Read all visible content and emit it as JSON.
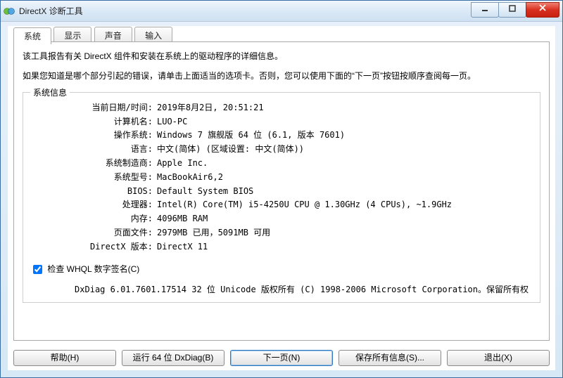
{
  "window": {
    "title": "DirectX 诊断工具"
  },
  "tabs": {
    "system": "系统",
    "display": "显示",
    "sound": "声音",
    "input": "输入"
  },
  "intro": {
    "line1": "该工具报告有关 DirectX 组件和安装在系统上的驱动程序的详细信息。",
    "line2": "如果您知道是哪个部分引起的错误，请单击上面适当的选项卡。否则，您可以使用下面的“下一页”按钮按顺序查阅每一页。"
  },
  "group_title": "系统信息",
  "sysinfo": {
    "datetime": {
      "label": "当前日期/时间:",
      "value": "2019年8月2日, 20:51:21"
    },
    "computer": {
      "label": "计算机名:",
      "value": "LUO-PC"
    },
    "os": {
      "label": "操作系统:",
      "value": "Windows 7 旗舰版 64 位 (6.1, 版本 7601)"
    },
    "language": {
      "label": "语言:",
      "value": "中文(简体) (区域设置: 中文(简体))"
    },
    "maker": {
      "label": "系统制造商:",
      "value": "Apple Inc."
    },
    "model": {
      "label": "系统型号:",
      "value": "MacBookAir6,2"
    },
    "bios": {
      "label": "BIOS:",
      "value": "Default System BIOS"
    },
    "cpu": {
      "label": "处理器:",
      "value": "Intel(R) Core(TM) i5-4250U CPU @ 1.30GHz (4 CPUs), ~1.9GHz"
    },
    "memory": {
      "label": "内存:",
      "value": "4096MB RAM"
    },
    "pagefile": {
      "label": "页面文件:",
      "value": "2979MB 已用，5091MB 可用"
    },
    "dxver": {
      "label": "DirectX 版本:",
      "value": "DirectX 11"
    }
  },
  "whql_label": "检查 WHQL 数字签名(C)",
  "copyright": "DxDiag 6.01.7601.17514 32 位 Unicode 版权所有 (C) 1998-2006 Microsoft Corporation。保留所有权",
  "buttons": {
    "help": "帮助(H)",
    "run64": "运行 64 位 DxDiag(B)",
    "next": "下一页(N)",
    "saveall": "保存所有信息(S)...",
    "exit": "退出(X)"
  }
}
